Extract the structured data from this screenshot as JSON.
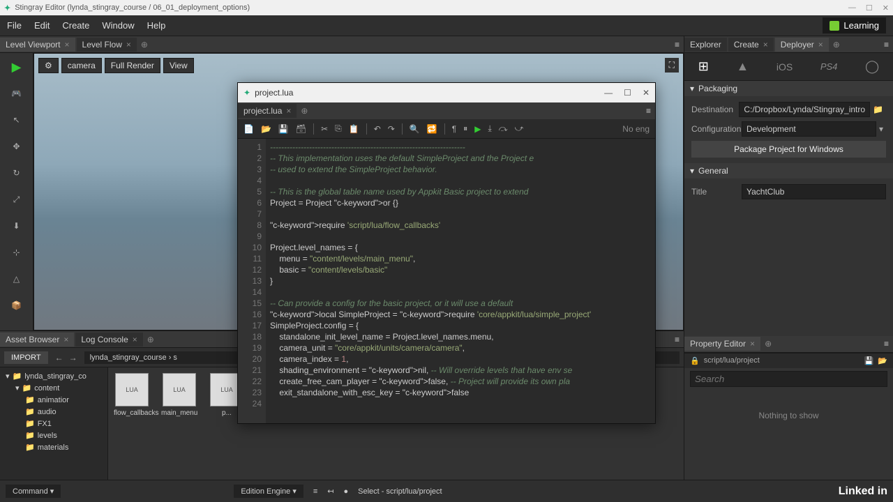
{
  "window": {
    "title": "Stingray Editor (lynda_stingray_course / 06_01_deployment_options)"
  },
  "menu": {
    "file": "File",
    "edit": "Edit",
    "create": "Create",
    "window": "Window",
    "help": "Help"
  },
  "learning": "Learning",
  "tabs_left": {
    "viewport": "Level Viewport",
    "flow": "Level Flow"
  },
  "viewport": {
    "camera": "camera",
    "render": "Full Render",
    "view": "View"
  },
  "tabs_right": {
    "explorer": "Explorer",
    "create": "Create",
    "deployer": "Deployer"
  },
  "deployer": {
    "packaging_hdr": "Packaging",
    "dest_label": "Destination",
    "dest_val": "C:/Dropbox/Lynda/Stingray_intro",
    "config_label": "Configuration",
    "config_val": "Development",
    "package_btn": "Package Project for Windows",
    "general_hdr": "General",
    "title_label": "Title",
    "title_val": "YachtClub"
  },
  "property_editor": {
    "tab": "Property Editor",
    "path": "script/lua/project",
    "search_ph": "Search",
    "empty": "Nothing to show"
  },
  "asset_browser": {
    "tab": "Asset Browser",
    "log": "Log Console",
    "import": "IMPORT",
    "breadcrumb": "lynda_stingray_course › s",
    "tree_root": "lynda_stingray_co",
    "tree_content": "content",
    "tree_items": [
      "animatior",
      "audio",
      "FX1",
      "levels",
      "materials"
    ],
    "assets": [
      "flow_callbacks",
      "main_menu",
      "p..."
    ]
  },
  "editor": {
    "title": "project.lua",
    "tab": "project.lua",
    "noeng": "No eng",
    "lines": [
      {
        "n": 1,
        "cls": "c-comment",
        "t": "----------------------------------------------------------------------"
      },
      {
        "n": 2,
        "cls": "c-comment",
        "t": "-- This implementation uses the default SimpleProject and the Project e"
      },
      {
        "n": 3,
        "cls": "c-comment",
        "t": "-- used to extend the SimpleProject behavior."
      },
      {
        "n": 4,
        "cls": "",
        "t": ""
      },
      {
        "n": 5,
        "cls": "c-comment",
        "t": "-- This is the global table name used by Appkit Basic project to extend"
      },
      {
        "n": 6,
        "cls": "",
        "t": "Project = Project or {}"
      },
      {
        "n": 7,
        "cls": "",
        "t": ""
      },
      {
        "n": 8,
        "cls": "",
        "t": "require 'script/lua/flow_callbacks'"
      },
      {
        "n": 9,
        "cls": "",
        "t": ""
      },
      {
        "n": 10,
        "cls": "",
        "t": "Project.level_names = {"
      },
      {
        "n": 11,
        "cls": "",
        "t": "    menu = \"content/levels/main_menu\","
      },
      {
        "n": 12,
        "cls": "",
        "t": "    basic = \"content/levels/basic\""
      },
      {
        "n": 13,
        "cls": "",
        "t": "}"
      },
      {
        "n": 14,
        "cls": "",
        "t": ""
      },
      {
        "n": 15,
        "cls": "c-comment",
        "t": "-- Can provide a config for the basic project, or it will use a default"
      },
      {
        "n": 16,
        "cls": "",
        "t": "local SimpleProject = require 'core/appkit/lua/simple_project'"
      },
      {
        "n": 17,
        "cls": "",
        "t": "SimpleProject.config = {"
      },
      {
        "n": 18,
        "cls": "",
        "t": "    standalone_init_level_name = Project.level_names.menu,"
      },
      {
        "n": 19,
        "cls": "",
        "t": "    camera_unit = \"core/appkit/units/camera/camera\","
      },
      {
        "n": 20,
        "cls": "",
        "t": "    camera_index = 1,"
      },
      {
        "n": 21,
        "cls": "",
        "t": "    shading_environment = nil, -- Will override levels that have env se"
      },
      {
        "n": 22,
        "cls": "",
        "t": "    create_free_cam_player = false, -- Project will provide its own pla"
      },
      {
        "n": 23,
        "cls": "",
        "t": "    exit_standalone_with_esc_key = false"
      },
      {
        "n": 24,
        "cls": "",
        "t": ""
      }
    ]
  },
  "status": {
    "command": "Command ▾",
    "engine": "Edition Engine ▾",
    "select": "Select - script/lua/project",
    "linkedin": "Linked in"
  }
}
